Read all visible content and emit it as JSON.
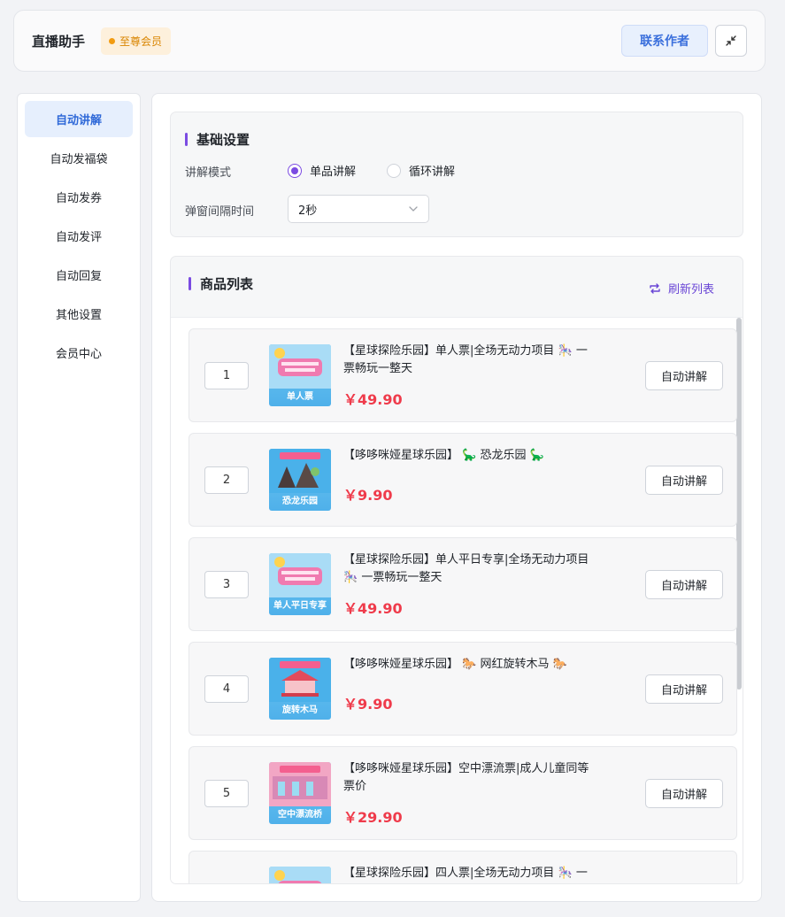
{
  "header": {
    "title": "直播助手",
    "badge": "至尊会员",
    "contact_label": "联系作者",
    "shrink_icon": "shrink-icon"
  },
  "sidebar": {
    "items": [
      {
        "label": "自动讲解",
        "active": true
      },
      {
        "label": "自动发福袋"
      },
      {
        "label": "自动发券"
      },
      {
        "label": "自动发评"
      },
      {
        "label": "自动回复"
      },
      {
        "label": "其他设置"
      },
      {
        "label": "会员中心"
      }
    ]
  },
  "settings": {
    "title": "基础设置",
    "mode_label": "讲解模式",
    "mode_options": [
      "单品讲解",
      "循环讲解"
    ],
    "mode_selected": "单品讲解",
    "interval_label": "弹窗间隔时间",
    "interval_value": "2秒"
  },
  "products": {
    "title": "商品列表",
    "refresh_label": "刷新列表",
    "button_label": "自动讲解",
    "items": [
      {
        "index": "1",
        "line1": "【星球探险乐园】单人票|全场无动力项目 🎠 一",
        "line2": "票畅玩一整天",
        "price": "￥49.90",
        "thumb_caption": "单人票"
      },
      {
        "index": "2",
        "line1": "【哆哆咪娅星球乐园】 🦕 恐龙乐园 🦕",
        "line2": "",
        "price": "￥9.90",
        "thumb_caption": "恐龙乐园"
      },
      {
        "index": "3",
        "line1": "【星球探险乐园】单人平日专享|全场无动力项目",
        "line2": "🎠 一票畅玩一整天",
        "price": "￥49.90",
        "thumb_caption": "单人平日专享"
      },
      {
        "index": "4",
        "line1": "【哆哆咪娅星球乐园】 🐎 网红旋转木马 🐎",
        "line2": "",
        "price": "￥9.90",
        "thumb_caption": "旋转木马"
      },
      {
        "index": "5",
        "line1": "【哆哆咪娅星球乐园】空中漂流票|成人儿童同等",
        "line2": "票价",
        "price": "￥29.90",
        "thumb_caption": "空中漂流桥"
      },
      {
        "index": "6",
        "line1": "【星球探险乐园】四人票|全场无动力项目 🎠 一",
        "line2": "",
        "price": "",
        "thumb_caption": ""
      }
    ]
  },
  "colors": {
    "accent": "#7b4be2",
    "price": "#ef3b4b",
    "active_nav": "#2f69d8",
    "badge": "#d98500"
  }
}
